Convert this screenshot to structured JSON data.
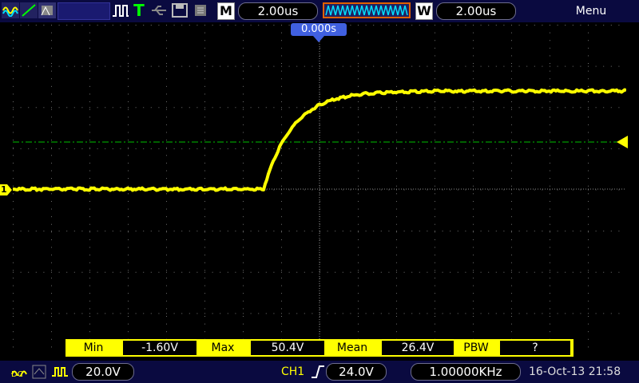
{
  "top": {
    "timebase": "2.00us",
    "window_timebase": "2.00us",
    "trigger_pos": "0.000s",
    "menu_label": "Menu",
    "main_label": "M",
    "window_label": "W",
    "trig_mode_label": "T"
  },
  "measurements": [
    {
      "label": "Min",
      "value": "-1.60V"
    },
    {
      "label": "Max",
      "value": "50.4V"
    },
    {
      "label": "Mean",
      "value": "26.4V"
    },
    {
      "label": "PBW",
      "value": "?"
    }
  ],
  "bottom": {
    "coupling": "DC",
    "ch1_scale": "20.0V",
    "trigger_source": "CH1",
    "trigger_level": "24.0V",
    "frequency": "1.00000KHz",
    "datetime": "16-Oct-13 21:58",
    "channel_marker": "1"
  },
  "colors": {
    "trace": "#ffff00",
    "trigger_line": "#00c000",
    "bar_bg": "#0a0a40"
  },
  "icons": [
    "waveform-icon",
    "ramp-icon",
    "persist-icon",
    "pulse-icon",
    "usb-icon",
    "save-icon",
    "print-icon",
    "trigger-edge-icon"
  ]
}
